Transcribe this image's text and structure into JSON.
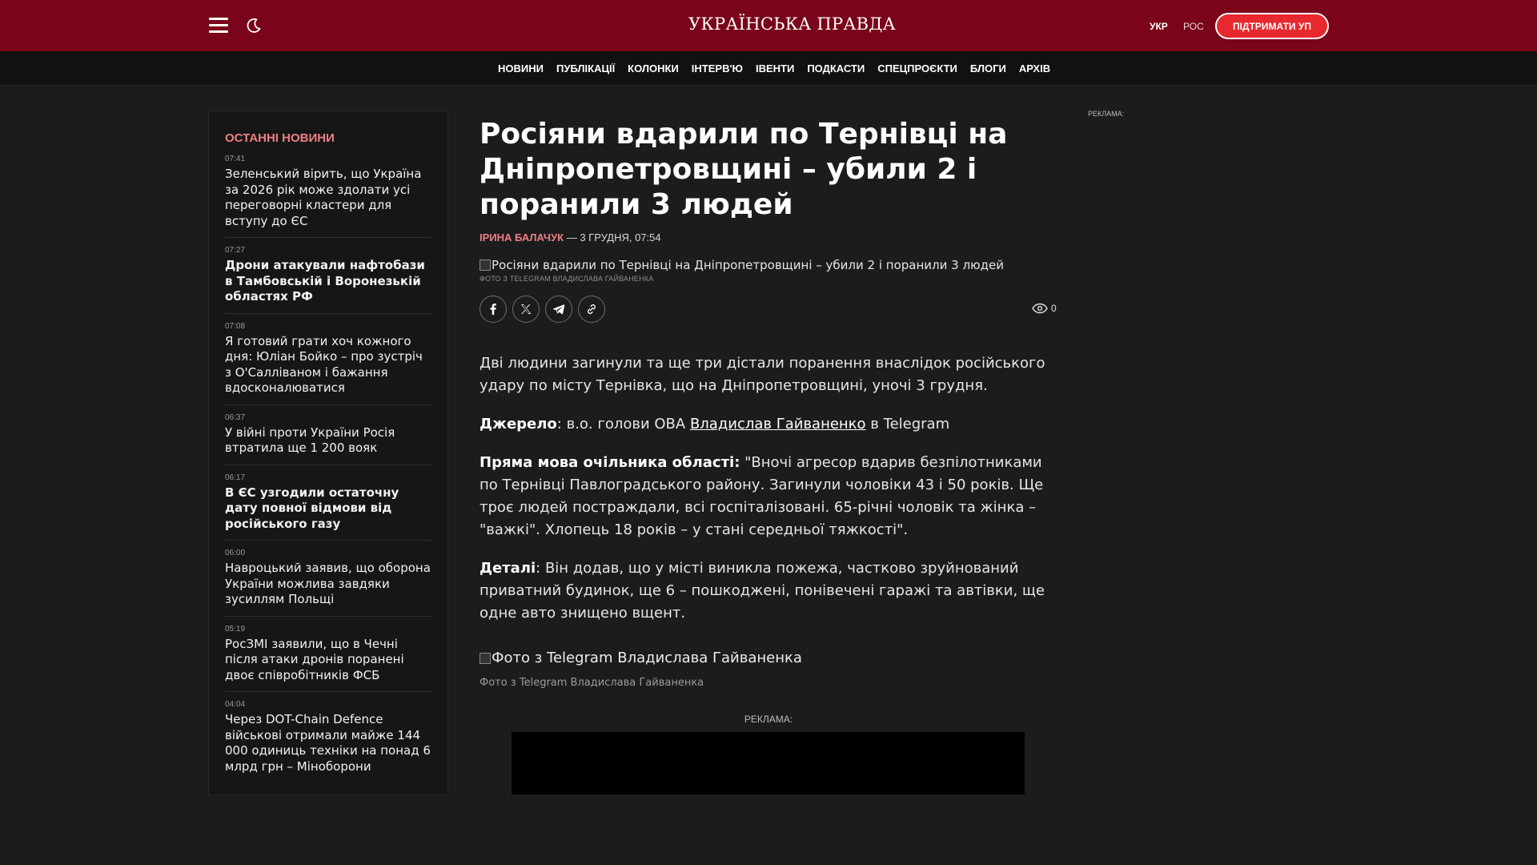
{
  "header": {
    "logo": "УКРАЇНСЬКА ПРАВДА",
    "lang_ukr": "УКР",
    "lang_ros": "РОС",
    "support_label": "ПІДТРИМАТИ УП",
    "menu_icon": "hamburger-menu-icon",
    "theme_icon": "moon-icon",
    "brand_color": "#7a0419",
    "accent_color": "#e8282f"
  },
  "nav": {
    "items": [
      "НОВИНИ",
      "ПУБЛІКАЦІЇ",
      "КОЛОНКИ",
      "ІНТЕРВ'Ю",
      "ІВЕНТИ",
      "ПОДКАСТИ",
      "СПЕЦПРОЄКТИ",
      "БЛОГИ",
      "АРХІВ"
    ]
  },
  "sidebar": {
    "title": "ОСТАННІ НОВИНИ",
    "news": [
      {
        "time": "07:41",
        "title": "Зеленський вірить, що Україна за 2026 рік може здолати усі переговорні кластери для вступу до ЄС"
      },
      {
        "time": "07:27",
        "title": "Дрони атакували нафтобази в Тамбовській і Воронезькій областях РФ"
      },
      {
        "time": "07:08",
        "title": "Я готовий грати хоч кожного дня: Юліан Бойко – про зустріч з О'Салліваном і бажання вдосконалюватися"
      },
      {
        "time": "06:37",
        "title": "У війні проти України Росія втратила ще 1 200 вояк"
      },
      {
        "time": "06:17",
        "title": "В ЄС узгодили остаточну дату повної відмови від російського газу"
      },
      {
        "time": "06:00",
        "title": "Навроцький заявив, що оборона України можлива завдяки зусиллям Польщі"
      },
      {
        "time": "05:19",
        "title": "РосЗМІ заявили, що в Чечні після атаки дронів поранені двоє співробітників ФСБ"
      },
      {
        "time": "04:04",
        "title": "Через DOT-Chain Defence військові отримали майже 144 000 одиниць техніки на понад 6 млрд грн – Міноборони"
      }
    ]
  },
  "article": {
    "title": "Росіяни вдарили по Тернівці на Дніпропетровщині – убили 2 і поранили 3 людей",
    "author": "ІРИНА БАЛАЧУК",
    "date": " — 3 ГРУДНЯ, 07:54",
    "main_photo_alt": "Росіяни вдарили по Тернівці на Дніпропетровщині – убили 2 і поранили 3 людей",
    "main_photo_credit": "ФОТО З TELEGRAM ВЛАДИСЛАВА ГАЙВАНЕНКА",
    "views": "0",
    "lead": "Дві людини загинули та ще три дістали поранення внаслідок російського удару по місту Тернівка, що на Дніпропетровщині, уночі 3 грудня.",
    "source_label": "Джерело",
    "source_pre": ": в.о. голови ОВА ",
    "source_link": "Владислав Гайваненко",
    "source_post": " в Telegram",
    "quote_label": "Пряма мова очільника області:",
    "quote_text": " \"Вночі агресор вдарив безпілотниками по Тернівці Павлоградського району. Загинули чоловіки 43 і 50 років. Ще троє людей постраждали, всі госпіталізовані. 65-річні чоловік та жінка – \"важкі\". Хлопець 18 років – у стані середньої тяжкості\".",
    "details_label": "Деталі",
    "details_text": ": Він додав, що у місті виникла пожежа, частково зруйнований приватний будинок, ще 6 – пошкоджені, понівечені гаражі та автівки, ще одне авто знищено вщент.",
    "inline_photo_alt": "Фото з Telegram Владислава Гайваненка",
    "inline_photo_caption": "Фото з Telegram Владислава Гайваненка"
  },
  "ads": {
    "label_right": "РЕКЛАМА:",
    "label_center": "РЕКЛАМА:"
  }
}
